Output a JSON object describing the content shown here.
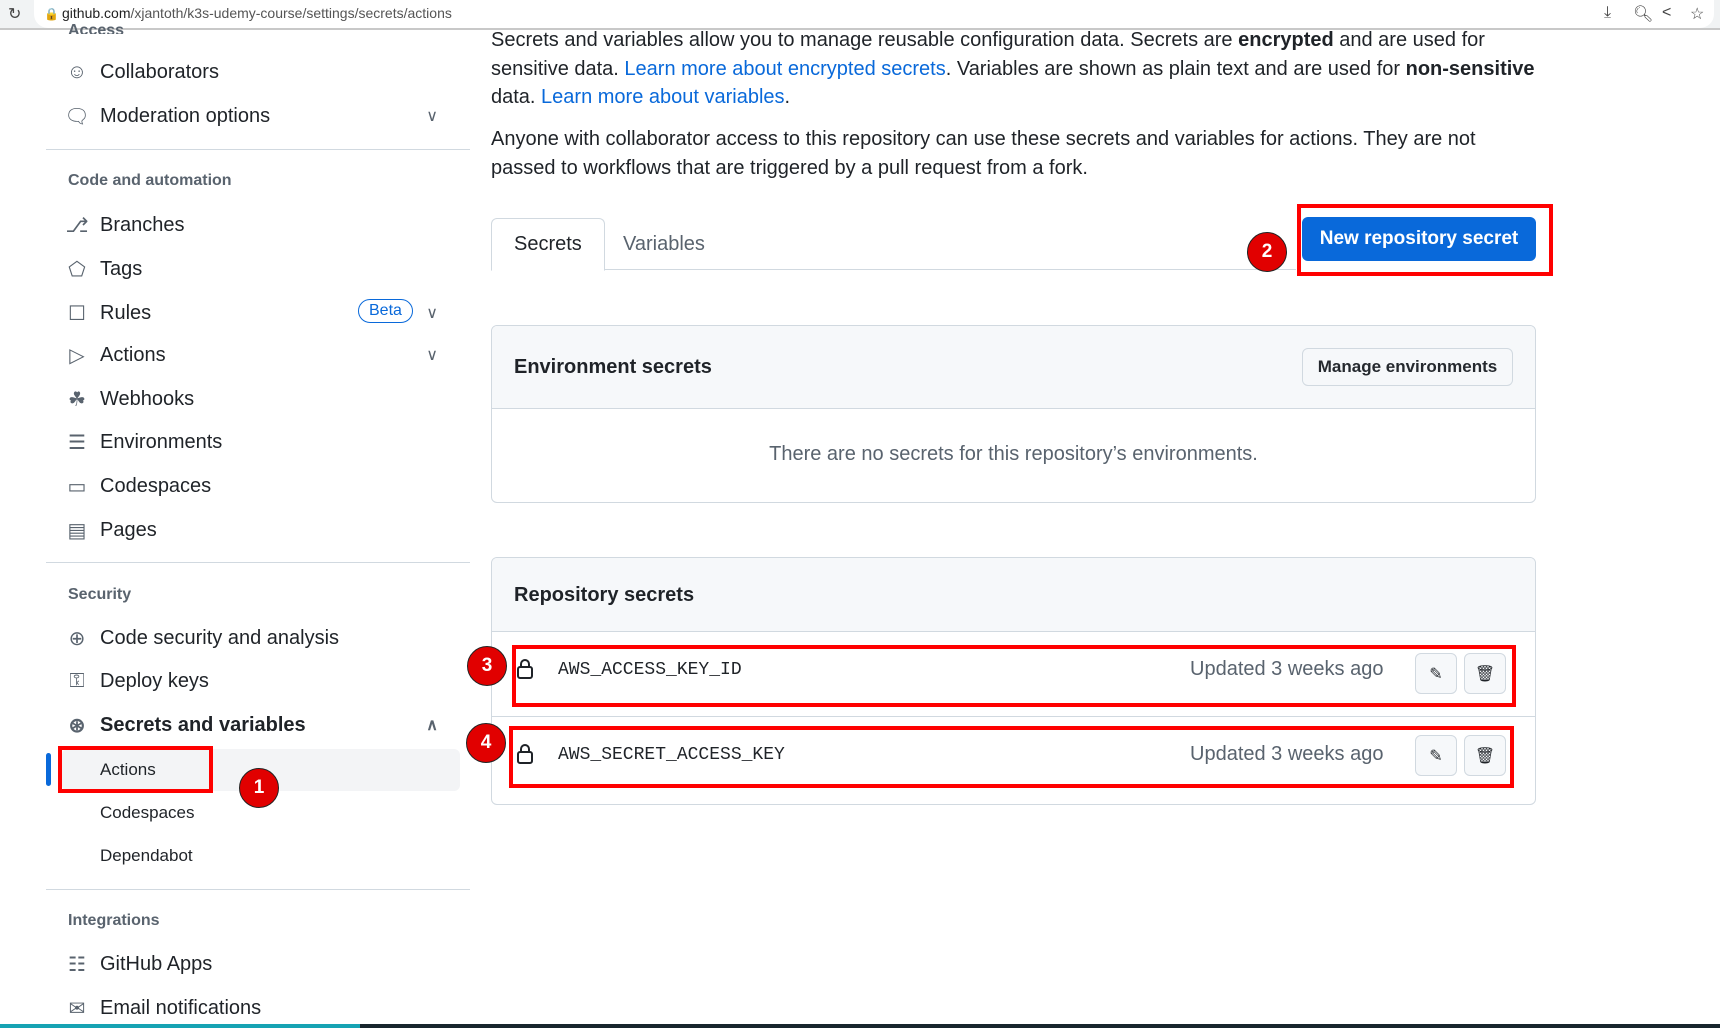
{
  "browser": {
    "url_host": "github.com",
    "url_path": "/xjantoth/k3s-udemy-course/settings/secrets/actions"
  },
  "sidebar": {
    "access_heading": "Access",
    "access_items": [
      {
        "label": "Collaborators",
        "icon": "people-icon"
      },
      {
        "label": "Moderation options",
        "icon": "comment-discussion-icon",
        "expandable": true
      }
    ],
    "code_heading": "Code and automation",
    "code_items": [
      {
        "label": "Branches",
        "icon": "branch-icon"
      },
      {
        "label": "Tags",
        "icon": "tag-icon"
      },
      {
        "label": "Rules",
        "icon": "rules-icon",
        "badge": "Beta",
        "expandable": true
      },
      {
        "label": "Actions",
        "icon": "play-icon",
        "expandable": true
      },
      {
        "label": "Webhooks",
        "icon": "webhook-icon"
      },
      {
        "label": "Environments",
        "icon": "server-icon"
      },
      {
        "label": "Codespaces",
        "icon": "codespaces-icon"
      },
      {
        "label": "Pages",
        "icon": "browser-icon"
      }
    ],
    "security_heading": "Security",
    "security_items": [
      {
        "label": "Code security and analysis",
        "icon": "codescan-icon"
      },
      {
        "label": "Deploy keys",
        "icon": "key-icon"
      },
      {
        "label": "Secrets and variables",
        "icon": "asterisk-icon",
        "expanded": true
      }
    ],
    "secrets_sub": [
      {
        "label": "Actions",
        "selected": true
      },
      {
        "label": "Codespaces"
      },
      {
        "label": "Dependabot"
      }
    ],
    "integrations_heading": "Integrations",
    "integration_items": [
      {
        "label": "GitHub Apps",
        "icon": "apps-icon"
      },
      {
        "label": "Email notifications",
        "icon": "mail-icon"
      }
    ]
  },
  "intro": {
    "p1_a": "Secrets and variables allow you to manage reusable configuration data. Secrets are ",
    "p1_b": "encrypted",
    "p1_c": " and are used for sensitive data. ",
    "p1_link1": "Learn more about encrypted secrets",
    "p1_d": ". Variables are shown as plain text and are used for ",
    "p1_e": "non-sensitive",
    "p1_f": " data. ",
    "p1_link2": "Learn more about variables",
    "p1_g": ".",
    "p2": "Anyone with collaborator access to this repository can use these secrets and variables for actions. They are not passed to workflows that are triggered by a pull request from a fork."
  },
  "tabs": [
    {
      "label": "Secrets",
      "active": true
    },
    {
      "label": "Variables"
    }
  ],
  "new_secret_button": "New repository secret",
  "env_secrets": {
    "title": "Environment secrets",
    "manage_button": "Manage environments",
    "empty": "There are no secrets for this repository’s environments."
  },
  "repo_secrets": {
    "title": "Repository secrets",
    "rows": [
      {
        "name": "AWS_ACCESS_KEY_ID",
        "updated": "Updated 3 weeks ago"
      },
      {
        "name": "AWS_SECRET_ACCESS_KEY",
        "updated": "Updated 3 weeks ago"
      }
    ]
  },
  "annotations": [
    "1",
    "2",
    "3",
    "4"
  ],
  "colors": {
    "accent": "#0969da",
    "annotation_red": "#ff0000"
  }
}
